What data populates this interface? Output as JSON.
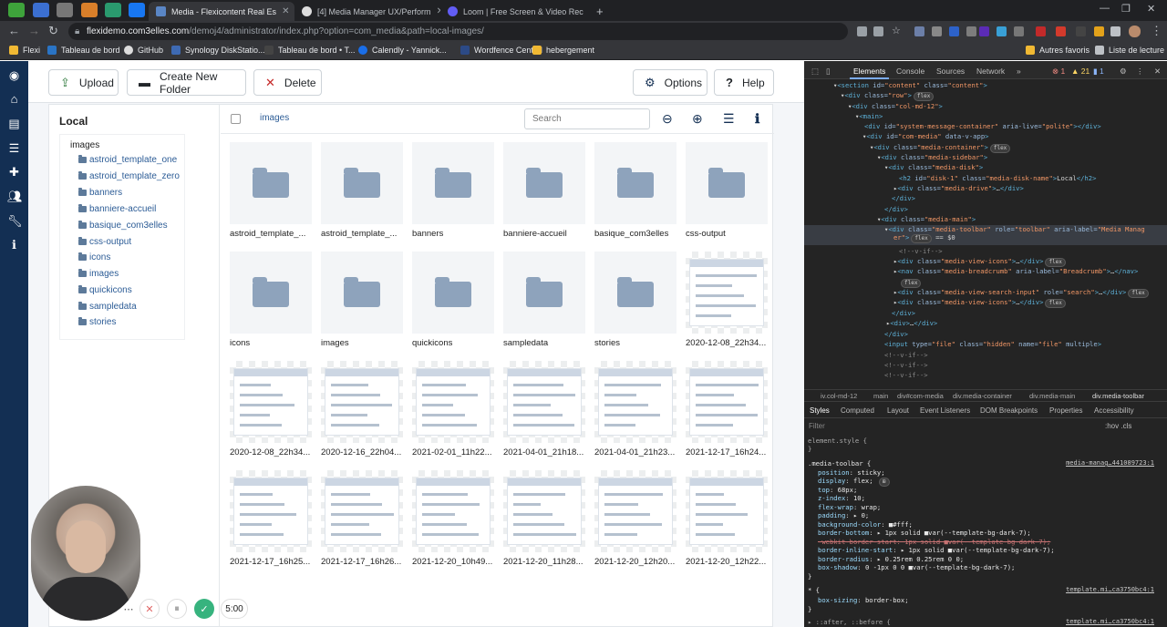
{
  "browser": {
    "tabs": [
      {
        "label": "Media - Flexicontent Real Es"
      },
      {
        "label": "[4] Media Manager UX/Perform"
      },
      {
        "label": "Loom | Free Screen & Video Rec"
      }
    ],
    "new_tab": "+",
    "url_domain": "flexidemo.com3elles.com",
    "url_path": "/demoj4/administrator/index.php?option=com_media&path=local-images/",
    "bookmarks": [
      "Flexi",
      "Tableau de bord",
      "GitHub",
      "Synology DiskStatio...",
      "Tableau de bord • T...",
      "Calendly - Yannick...",
      "Wordfence Central",
      "hebergement"
    ],
    "bookmarks_right": [
      "Autres favoris",
      "Liste de lecture"
    ]
  },
  "toolbar": {
    "upload": "Upload",
    "create_folder": "Create New Folder",
    "delete": "Delete",
    "options": "Options",
    "help": "Help"
  },
  "disk": {
    "title": "Local",
    "root": "images",
    "folders": [
      "astroid_template_one",
      "astroid_template_zero",
      "banners",
      "banniere-accueil",
      "basique_com3elles",
      "css-output",
      "icons",
      "images",
      "quickicons",
      "sampledata",
      "stories"
    ]
  },
  "media": {
    "breadcrumb": "images",
    "search_placeholder": "Search",
    "items": [
      {
        "name": "astroid_template_...",
        "kind": "folder"
      },
      {
        "name": "astroid_template_...",
        "kind": "folder"
      },
      {
        "name": "banners",
        "kind": "folder"
      },
      {
        "name": "banniere-accueil",
        "kind": "folder"
      },
      {
        "name": "basique_com3elles",
        "kind": "folder"
      },
      {
        "name": "css-output",
        "kind": "folder"
      },
      {
        "name": "icons",
        "kind": "folder"
      },
      {
        "name": "images",
        "kind": "folder"
      },
      {
        "name": "quickicons",
        "kind": "folder"
      },
      {
        "name": "sampledata",
        "kind": "folder"
      },
      {
        "name": "stories",
        "kind": "folder"
      },
      {
        "name": "2020-12-08_22h34...",
        "kind": "image"
      },
      {
        "name": "2020-12-08_22h34...",
        "kind": "image"
      },
      {
        "name": "2020-12-16_22h04...",
        "kind": "image"
      },
      {
        "name": "2021-02-01_11h22...",
        "kind": "image"
      },
      {
        "name": "2021-04-01_21h18...",
        "kind": "image"
      },
      {
        "name": "2021-04-01_21h23...",
        "kind": "image"
      },
      {
        "name": "2021-12-17_16h24...",
        "kind": "image"
      },
      {
        "name": "2021-12-17_16h25...",
        "kind": "image"
      },
      {
        "name": "2021-12-17_16h26...",
        "kind": "image"
      },
      {
        "name": "2021-12-20_10h49...",
        "kind": "image"
      },
      {
        "name": "2021-12-20_11h28...",
        "kind": "image"
      },
      {
        "name": "2021-12-20_12h20...",
        "kind": "image"
      },
      {
        "name": "2021-12-20_12h22...",
        "kind": "image"
      }
    ]
  },
  "devtools": {
    "tabs": [
      "Elements",
      "Console",
      "Sources",
      "Network"
    ],
    "badges": [
      "1",
      "21",
      "1"
    ],
    "breadcrumbs": [
      "iv.col-md-12",
      "main",
      "div#com-media",
      "div.media-container",
      "div.media-main",
      "div.media-toolbar"
    ],
    "style_tabs": [
      "Styles",
      "Computed",
      "Layout",
      "Event Listeners",
      "DOM Breakpoints",
      "Properties",
      "Accessibility"
    ],
    "filter": "Filter",
    "filter_right": ":hov .cls",
    "rule_selector": ".media-toolbar {",
    "rule_source": "media-manag…441089723:1",
    "box_source": "template.mi…ca3750bc4:1",
    "after_source": "template.mi…ca3750bc4:1"
  },
  "recorder": {
    "timer": "5:00"
  }
}
